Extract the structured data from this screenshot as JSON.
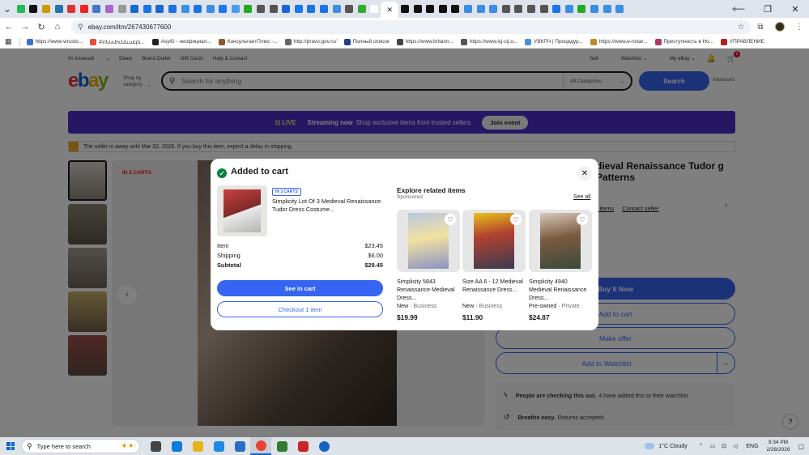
{
  "browser": {
    "tab_favicon_colors": [
      "#2b5",
      "#111",
      "#c90",
      "#27a",
      "#d33",
      "#e22",
      "#47c",
      "#a6c",
      "#999",
      "#1967d2",
      "#1a73e8",
      "#1967d2",
      "#1a73e8",
      "#3a8ee6",
      "#1a73e8",
      "#3a8ee6",
      "#1877f2",
      "#4a9af0",
      "#2a2",
      "#555",
      "#555",
      "#1967d2",
      "#1877f2",
      "#1a73e8",
      "#1a73e8",
      "#3a8ee6",
      "#555",
      "#3a3",
      "#fff",
      "#111",
      "#111",
      "#111",
      "#111",
      "#111",
      "#3a8ee6",
      "#3a8ee6",
      "#3a8ee6",
      "#555",
      "#555",
      "#555",
      "#555",
      "#1a73e8",
      "#3a8ee6",
      "#2a2",
      "#3a8ee6",
      "#3a8ee6",
      "#3a8ee6"
    ],
    "active_tab_close": "✕",
    "new_tab": "+",
    "url": "ebay.com/itm/267430677600",
    "bookmarks": [
      {
        "label": "https://www.virusto...",
        "color": "#3b6fd6"
      },
      {
        "label": "Բոնսմունևակն...",
        "color": "#e94b3c"
      },
      {
        "label": "AsylG - неофициал...",
        "color": "#222"
      },
      {
        "label": "КонсультантПлюс -...",
        "color": "#8b5a2b"
      },
      {
        "label": "http://pravo.gov.ru/",
        "color": "#666"
      },
      {
        "label": "Полный список",
        "color": "#1f3c88"
      },
      {
        "label": "https://www.britann...",
        "color": "#444"
      },
      {
        "label": "https://www.icj-cij.o...",
        "color": "#555"
      },
      {
        "label": "УВКПЧ | Процедур...",
        "color": "#4a90d9"
      },
      {
        "label": "https://www.e-notar...",
        "color": "#c08a2d"
      },
      {
        "label": "Преступность в Но...",
        "color": "#b03a6a"
      },
      {
        "label": "УПРАВЛЕНИЕ",
        "color": "#b22222"
      }
    ]
  },
  "page": {
    "nav": {
      "greeting": "Hi Алексей",
      "deals": "Deals",
      "brand_outlet": "Brand Outlet",
      "gift_cards": "Gift Cards",
      "help": "Help & Contact",
      "sell": "Sell",
      "watchlist": "Watchlist",
      "my_ebay": "My eBay",
      "cart_count": "1"
    },
    "logo": [
      "e",
      "b",
      "a",
      "y"
    ],
    "logo_colors": [
      "#e53238",
      "#0064d2",
      "#f5af02",
      "#86b817"
    ],
    "shop_by": "Shop by category",
    "search_placeholder": "Search for anything",
    "category": "All Categories",
    "search_button": "Search",
    "advanced": "Advanced",
    "live_banner": {
      "live": "LIVE",
      "stream": "Streaming now",
      "desc": "Shop exclusive items from trusted sellers",
      "join": "Join event"
    },
    "away_note": "The seller is away until Mar 02, 2026. If you buy this item, expect a delay in shipping.",
    "in_carts": "IN 3 CARTS",
    "title_partial": "dieval Renaissance Tudor g Patterns",
    "seller_links": [
      "r items",
      "Contact seller"
    ],
    "buy_now": "Buy It Now",
    "add_to_cart": "Add to cart",
    "make_offer": "Make offer",
    "add_watchlist": "Add to Watchlist",
    "info": [
      {
        "bold": "People are checking this out.",
        "text": "4 have added this to their watchlist."
      },
      {
        "bold": "Breathe easy.",
        "text": "Returns accepted."
      }
    ],
    "help": "?"
  },
  "modal": {
    "title": "Added to cart",
    "badge": "IN 3 CARTS",
    "item_title": "Simplicity Lot Of 3 Medieval Renaissance Tudor Dress Costume...",
    "rows": [
      {
        "label": "Item",
        "value": "$23.45"
      },
      {
        "label": "Shipping",
        "value": "$6.00"
      },
      {
        "label": "Subtotal",
        "value": "$29.45"
      }
    ],
    "see_in_cart": "See in cart",
    "checkout": "Checkout 1 item",
    "explore_title": "Explore related items",
    "sponsored": "Sponsored",
    "see_all": "See all",
    "related": [
      {
        "title": "Simplicity 5843 Renaissance Medieval Dress...",
        "condition": "New",
        "seller": "Business",
        "price": "$19.99"
      },
      {
        "title": "Size AA 6 - 12 Medieval Renaissance Dress...",
        "condition": "New",
        "seller": "Business",
        "price": "$11.90"
      },
      {
        "title": "Simplicity 4940 Medieval Renaissance Dress...",
        "condition": "Pre-owned",
        "seller": "Private",
        "price": "$24.87"
      }
    ]
  },
  "taskbar": {
    "search_placeholder": "Type here to search",
    "weather": "1°C  Cloudy",
    "lang": "ENG",
    "time": "9:34 PM",
    "date": "2/28/2026",
    "app_colors": [
      "#444",
      "#0f7bd8",
      "#e8b21b",
      "#1e88e5",
      "#2b6cc4",
      "#e94335",
      "#2e7d32",
      "#c62828",
      "#1565c0"
    ]
  }
}
